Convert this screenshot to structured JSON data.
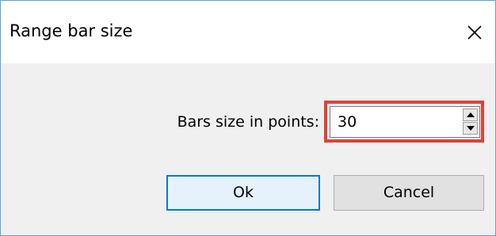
{
  "window": {
    "title": "Range bar size",
    "close_icon": "close-icon"
  },
  "form": {
    "label": "Bars size in points:",
    "value": "30",
    "spin_up_icon": "spin-up-arrow-icon",
    "spin_down_icon": "spin-down-arrow-icon",
    "highlight_color": "#e0403a"
  },
  "buttons": {
    "ok_label": "Ok",
    "cancel_label": "Cancel"
  },
  "colors": {
    "border_accent": "#56a8d8",
    "default_button_border": "#0078d7",
    "default_button_bg": "#e5f1fb"
  }
}
